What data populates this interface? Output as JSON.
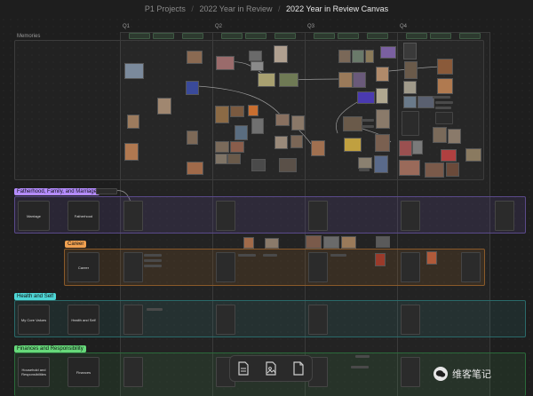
{
  "breadcrumbs": {
    "items": [
      "P1 Projects",
      "2022 Year in Review",
      "2022 Year in Review Canvas"
    ],
    "separator": "/"
  },
  "quarters": [
    "Q1",
    "Q2",
    "Q3",
    "Q4"
  ],
  "groups": {
    "memories": {
      "label": "Memories"
    },
    "family": {
      "label": "Fatherhood, Family, and Marriage",
      "color": "#b48cff",
      "cards": [
        "Marriage",
        "Fatherhood"
      ]
    },
    "career": {
      "label": "Career",
      "color": "#f0a050",
      "cards": [
        "Career"
      ]
    },
    "health": {
      "label": "Health and Self",
      "color": "#4ed6d6",
      "cards": [
        "My Core Values",
        "Health and Self"
      ]
    },
    "finances": {
      "label": "Finances and Responsibility",
      "color": "#66d97a",
      "cards": [
        "Household and Responsibilities",
        "Finances"
      ]
    }
  },
  "toolbar": {
    "icons": [
      "add-note-icon",
      "add-media-icon",
      "add-file-icon"
    ]
  },
  "watermark": {
    "text": "维客笔记",
    "icon": "wechat-icon"
  }
}
